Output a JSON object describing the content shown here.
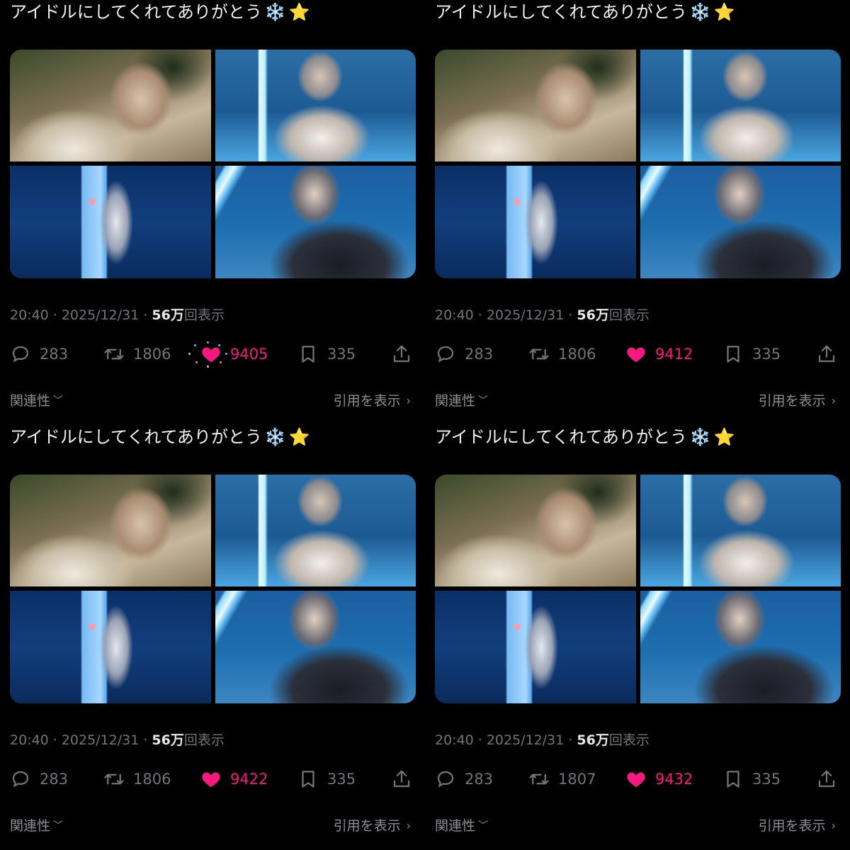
{
  "colors": {
    "background": "#000000",
    "text": "#e7e9ea",
    "muted": "#71767b",
    "like": "#f91880"
  },
  "panels": [
    {
      "text": "アイドルにしてくれてありがとう",
      "emoji_1": "❄️",
      "emoji_2": "⭐",
      "time": "20:40",
      "date": "2025/12/31",
      "views_num": "56万",
      "views_label": "回表示",
      "replies": "283",
      "retweets": "1806",
      "likes": "9405",
      "bookmarks": "335",
      "liked": true,
      "like_animating": true,
      "sort_label": "関連性",
      "quotes_label": "引用を表示"
    },
    {
      "text": "アイドルにしてくれてありがとう",
      "emoji_1": "❄️",
      "emoji_2": "⭐",
      "time": "20:40",
      "date": "2025/12/31",
      "views_num": "56万",
      "views_label": "回表示",
      "replies": "283",
      "retweets": "1806",
      "likes": "9412",
      "bookmarks": "335",
      "liked": true,
      "like_animating": false,
      "sort_label": "関連性",
      "quotes_label": "引用を表示"
    },
    {
      "text": "アイドルにしてくれてありがとう",
      "emoji_1": "❄️",
      "emoji_2": "⭐",
      "time": "20:40",
      "date": "2025/12/31",
      "views_num": "56万",
      "views_label": "回表示",
      "replies": "283",
      "retweets": "1806",
      "likes": "9422",
      "bookmarks": "335",
      "liked": true,
      "like_animating": false,
      "sort_label": "関連性",
      "quotes_label": "引用を表示"
    },
    {
      "text": "アイドルにしてくれてありがとう",
      "emoji_1": "❄️",
      "emoji_2": "⭐",
      "time": "20:40",
      "date": "2025/12/31",
      "views_num": "56万",
      "views_label": "回表示",
      "replies": "283",
      "retweets": "1807",
      "likes": "9432",
      "bookmarks": "335",
      "liked": true,
      "like_animating": false,
      "sort_label": "関連性",
      "quotes_label": "引用を表示"
    }
  ],
  "icons": [
    "reply-icon",
    "retweet-icon",
    "heart-icon",
    "bookmark-icon",
    "share-icon",
    "chevron-down-icon",
    "chevron-right-icon"
  ]
}
